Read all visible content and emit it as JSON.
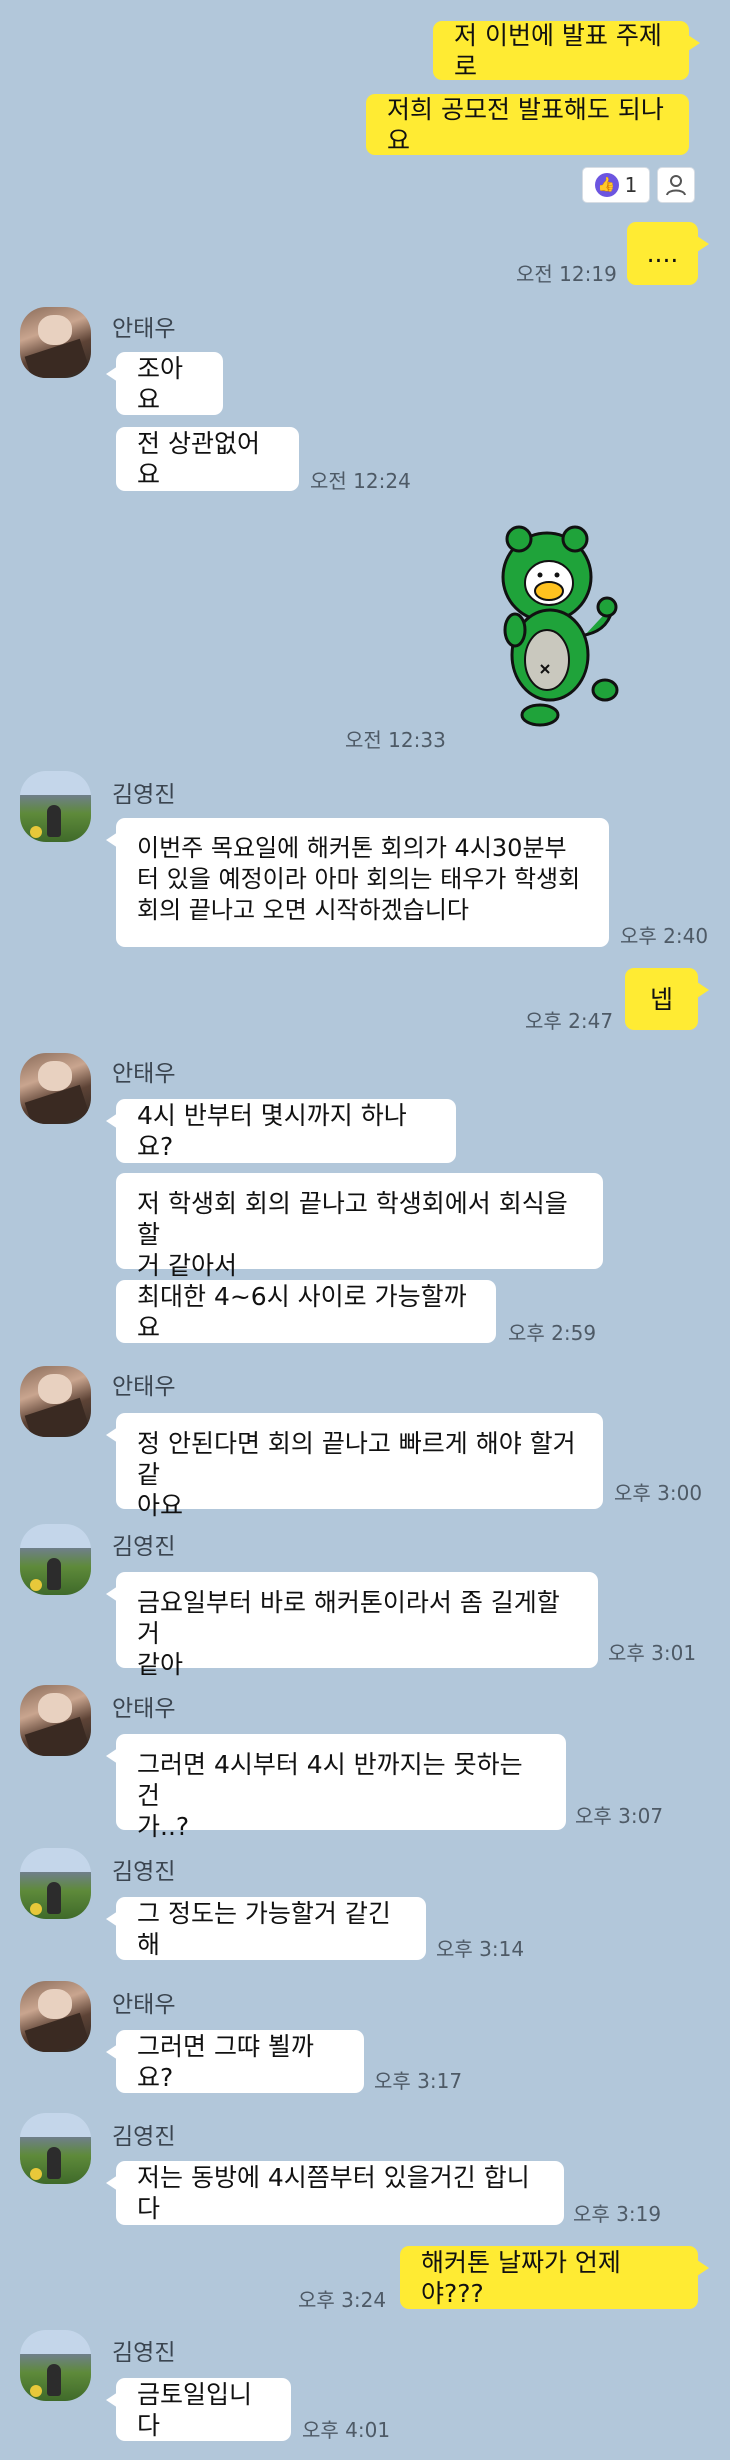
{
  "messages": [
    {
      "id": "m1",
      "text": "저 이번에 발표 주제로"
    },
    {
      "id": "m2",
      "text": "저희 공모전 발표해도 되나요"
    },
    {
      "id": "m3",
      "text": "...."
    },
    {
      "id": "m4",
      "text": "조아요"
    },
    {
      "id": "m5",
      "text": "전 상관없어요"
    },
    {
      "id": "m6",
      "text": "이번주 목요일에 해커톤 회의가 4시30분부\n터 있을 예정이라 아마 회의는 태우가 학생회\n회의 끝나고 오면 시작하겠습니다"
    },
    {
      "id": "m7",
      "text": "넵"
    },
    {
      "id": "m8",
      "text": "4시 반부터 몇시까지 하나요?"
    },
    {
      "id": "m9",
      "text": "저 학생회 회의 끝나고 학생회에서 회식을 할\n거 같아서"
    },
    {
      "id": "m10",
      "text": "최대한 4~6시 사이로 가능할까요"
    },
    {
      "id": "m11",
      "text": "정 안된다면 회의 끝나고 빠르게 해야 할거같\n아요"
    },
    {
      "id": "m12",
      "text": "금요일부터 바로 해커톤이라서 좀 길게할거\n같아"
    },
    {
      "id": "m13",
      "text": "그러면 4시부터 4시 반까지는 못하는 건\n가..?"
    },
    {
      "id": "m14",
      "text": "그 정도는 가능할거 같긴해"
    },
    {
      "id": "m15",
      "text": "그러면 그땨 뵐까요?"
    },
    {
      "id": "m16",
      "text": "저는 동방에 4시쯤부터 있을거긴 합니다"
    },
    {
      "id": "m17",
      "text": "해커톤 날짜가 언제야???"
    },
    {
      "id": "m18",
      "text": "금토일입니다"
    }
  ],
  "names": {
    "n1": "안태우",
    "n2": "김영진",
    "n3": "안태우",
    "n4": "안태우",
    "n5": "김영진",
    "n6": "안태우",
    "n7": "김영진",
    "n8": "안태우",
    "n9": "김영진",
    "n10": "김영진"
  },
  "times": {
    "t1": "오전 12:19",
    "t2": "오전 12:24",
    "t3": "오전 12:33",
    "t4": "오후 2:40",
    "t5": "오후 2:47",
    "t6": "오후 2:59",
    "t7": "오후 3:00",
    "t8": "오후 3:01",
    "t9": "오후 3:07",
    "t10": "오후 3:14",
    "t11": "오후 3:17",
    "t12": "오후 3:19",
    "t13": "오후 3:24",
    "t14": "오후 4:01"
  },
  "reactions": {
    "like_count": "1",
    "like_icon": "thumbs-up-icon",
    "person_icon": "person-icon"
  },
  "colors": {
    "background": "#b2c7da",
    "my_bubble": "#ffeb33",
    "other_bubble": "#ffffff",
    "like_badge": "#6c55e0",
    "sticker_green": "#1fa33a"
  }
}
